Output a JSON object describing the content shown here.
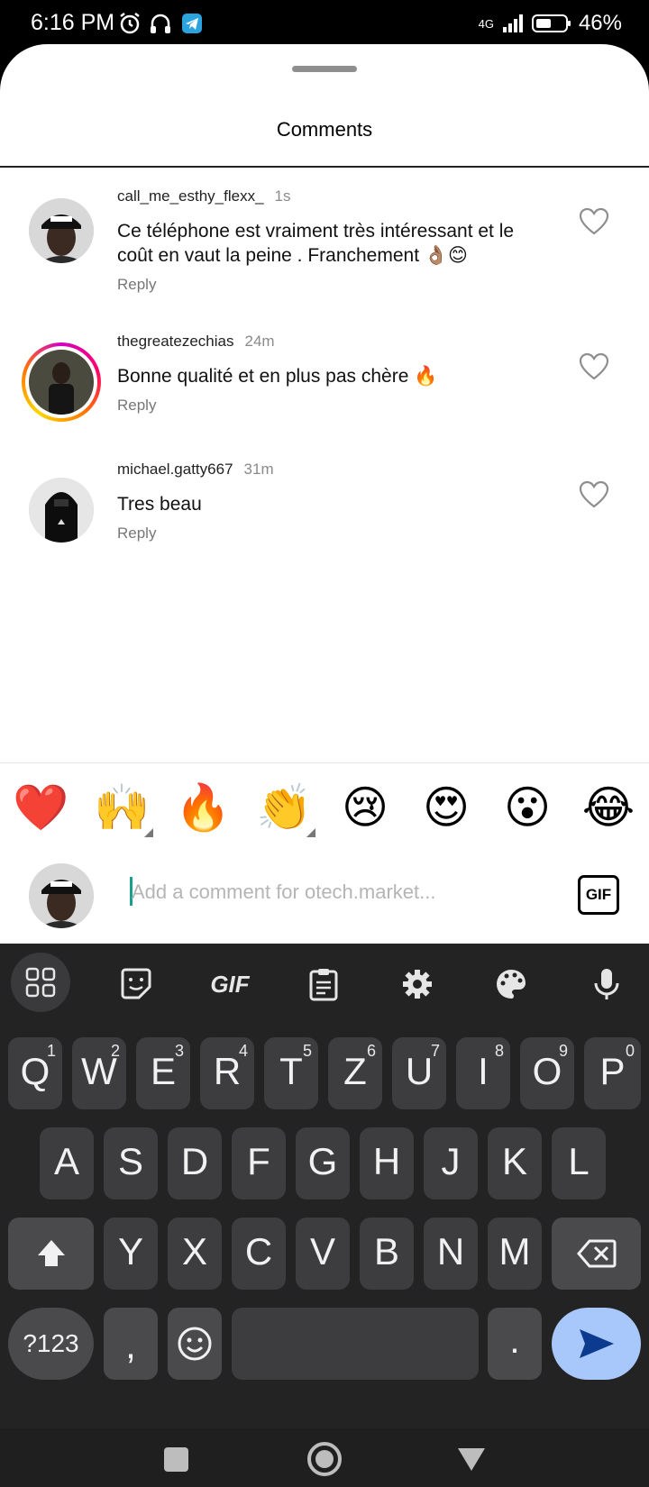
{
  "status_bar": {
    "time": "6:16 PM",
    "network": "4G",
    "battery": "46%"
  },
  "sheet": {
    "title": "Comments"
  },
  "comments": [
    {
      "username": "call_me_esthy_flexx_",
      "time": "1s",
      "text": "Ce téléphone est vraiment très intéressant et le coût en vaut la peine . Franchement 👌🏽😊",
      "reply": "Reply"
    },
    {
      "username": "thegreatezechias",
      "time": "24m",
      "text": "Bonne qualité et en plus pas chère 🔥",
      "reply": "Reply"
    },
    {
      "username": "michael.gatty667",
      "time": "31m",
      "text": "Tres beau",
      "reply": "Reply"
    }
  ],
  "quick_emojis": [
    "❤️",
    "🙌",
    "🔥",
    "👏",
    "😢",
    "😍",
    "😮",
    "😂"
  ],
  "comment_input": {
    "placeholder": "Add a comment for otech.market...",
    "gif_label": "GIF"
  },
  "keyboard": {
    "toolbar_gif": "GIF",
    "row1": [
      {
        "k": "Q",
        "n": "1"
      },
      {
        "k": "W",
        "n": "2"
      },
      {
        "k": "E",
        "n": "3"
      },
      {
        "k": "R",
        "n": "4"
      },
      {
        "k": "T",
        "n": "5"
      },
      {
        "k": "Z",
        "n": "6"
      },
      {
        "k": "U",
        "n": "7"
      },
      {
        "k": "I",
        "n": "8"
      },
      {
        "k": "O",
        "n": "9"
      },
      {
        "k": "P",
        "n": "0"
      }
    ],
    "row2": [
      "A",
      "S",
      "D",
      "F",
      "G",
      "H",
      "J",
      "K",
      "L"
    ],
    "row3": [
      "Y",
      "X",
      "C",
      "V",
      "B",
      "N",
      "M"
    ],
    "symbols_label": "?123",
    "comma_label": ",",
    "period_label": "."
  },
  "colors": {
    "send_button": "#a8c7fa",
    "send_arrow": "#0b3a8f",
    "heart_outline": "#8e8e8e",
    "caret": "#19a08a"
  }
}
